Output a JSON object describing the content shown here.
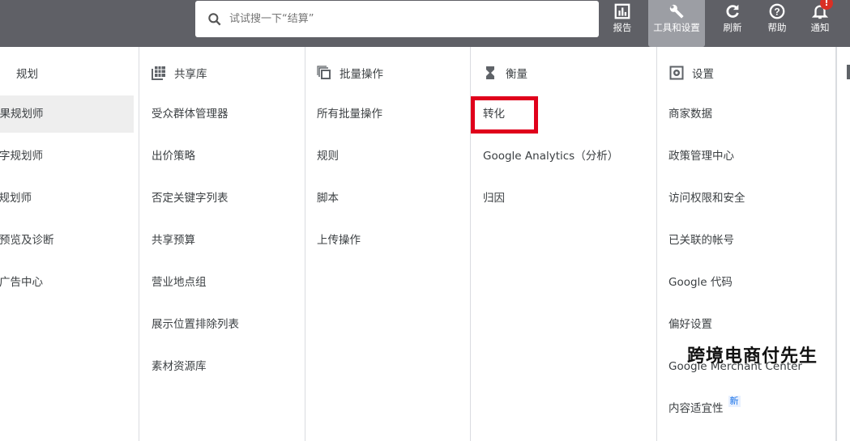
{
  "search": {
    "placeholder": "试试搜一下“结算”"
  },
  "toolbar": {
    "reports": "报告",
    "tools": "工具和设置",
    "refresh": "刷新",
    "help": "帮助",
    "notifications": "通知",
    "notification_badge": "!"
  },
  "columns": {
    "planning": {
      "title": "规划",
      "items": [
        "效果规划师",
        "关键字规划师",
        "覆盖面规划师",
        "广告预览及诊断",
        "应用广告中心"
      ]
    },
    "shared": {
      "title": "共享库",
      "items": [
        "受众群体管理器",
        "出价策略",
        "否定关键字列表",
        "共享预算",
        "营业地点组",
        "展示位置排除列表",
        "素材资源库"
      ]
    },
    "bulk": {
      "title": "批量操作",
      "items": [
        "所有批量操作",
        "规则",
        "脚本",
        "上传操作"
      ]
    },
    "measurement": {
      "title": "衡量",
      "items": [
        "转化",
        "Google Analytics（分析）",
        "归因"
      ]
    },
    "settings": {
      "title": "设置",
      "items": [
        "商家数据",
        "政策管理中心",
        "访问权限和安全",
        "已关联的帐号",
        "Google 代码",
        "偏好设置",
        "Google Merchant Center",
        "内容适宜性"
      ],
      "new_badge": "新"
    }
  },
  "watermark": "跨境电商付先生",
  "colors": {
    "topbar": "#5f6066",
    "highlight": "#e0001b"
  }
}
